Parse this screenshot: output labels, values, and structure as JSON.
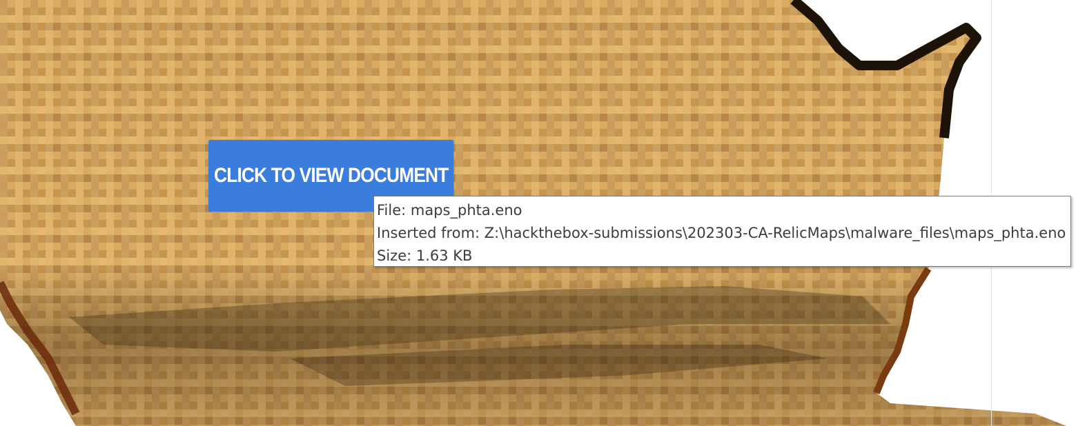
{
  "document": {
    "embedded_object": {
      "button_label": "CLICK TO VIEW DOCUMENT",
      "button_color": "#3b7ddd",
      "background_image_icon": "parchment-map-image"
    },
    "tooltip": {
      "file_line": "File: maps_phta.eno",
      "inserted_from_line": "Inserted from: Z:\\hackthebox-submissions\\202303-CA-RelicMaps\\malware_files\\maps_phta.eno",
      "size_line": "Size: 1.63 KB"
    }
  }
}
